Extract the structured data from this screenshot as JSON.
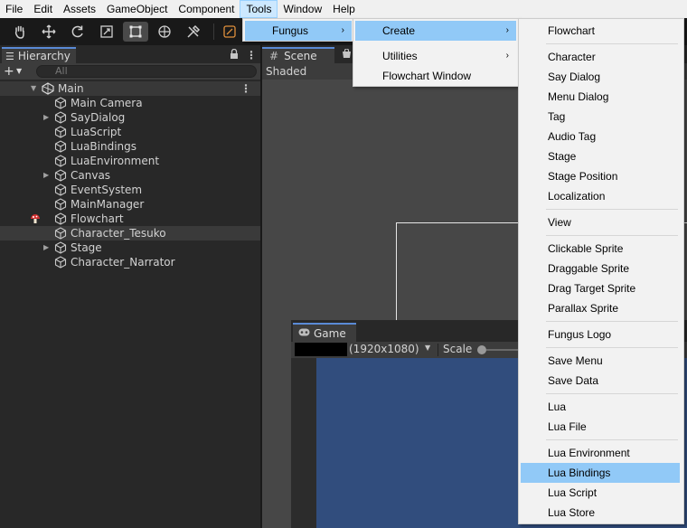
{
  "menubar": [
    "File",
    "Edit",
    "Assets",
    "GameObject",
    "Component",
    "Tools",
    "Window",
    "Help"
  ],
  "hierarchy": {
    "tab_label": "Hierarchy",
    "search_placeholder": "All",
    "root": "Main",
    "items": [
      {
        "label": "Main Camera",
        "expandable": false
      },
      {
        "label": "SayDialog",
        "expandable": true
      },
      {
        "label": "LuaScript",
        "expandable": false
      },
      {
        "label": "LuaBindings",
        "expandable": false
      },
      {
        "label": "LuaEnvironment",
        "expandable": false
      },
      {
        "label": "Canvas",
        "expandable": true
      },
      {
        "label": "EventSystem",
        "expandable": false
      },
      {
        "label": "MainManager",
        "expandable": false
      },
      {
        "label": "Flowchart",
        "expandable": false
      },
      {
        "label": "Character_Tesuko",
        "expandable": false
      },
      {
        "label": "Stage",
        "expandable": true
      },
      {
        "label": "Character_Narrator",
        "expandable": false
      }
    ]
  },
  "scene": {
    "tab_label": "Scene",
    "shading_mode": "Shaded"
  },
  "game": {
    "tab_label": "Game",
    "resolution": "(1920x1080)",
    "scale_label": "Scale"
  },
  "menus": {
    "tools_menu": {
      "items": [
        "Fungus"
      ]
    },
    "fungus_menu": {
      "items": [
        "Create",
        "Utilities",
        "Flowchart Window"
      ]
    },
    "create_menu": {
      "groups": [
        [
          "Flowchart"
        ],
        [
          "Character",
          "Say Dialog",
          "Menu Dialog",
          "Tag",
          "Audio Tag",
          "Stage",
          "Stage Position",
          "Localization"
        ],
        [
          "View"
        ],
        [
          "Clickable Sprite",
          "Draggable Sprite",
          "Drag Target Sprite",
          "Parallax Sprite"
        ],
        [
          "Fungus Logo"
        ],
        [
          "Save Menu",
          "Save Data"
        ],
        [
          "Lua",
          "Lua File"
        ],
        [
          "Lua Environment",
          "Lua Bindings",
          "Lua Script",
          "Lua Store"
        ]
      ],
      "highlighted": "Lua Bindings"
    }
  },
  "colors": {
    "menu_highlight": "#91c9f7",
    "game_background": "#314d7d",
    "tab_accent": "#5a8ad6"
  },
  "icons": {
    "hierarchy_item": "gameobject-cube-icon",
    "flowchart_gizmo": "mushroom-icon",
    "scene_root": "unity-logo-icon"
  }
}
